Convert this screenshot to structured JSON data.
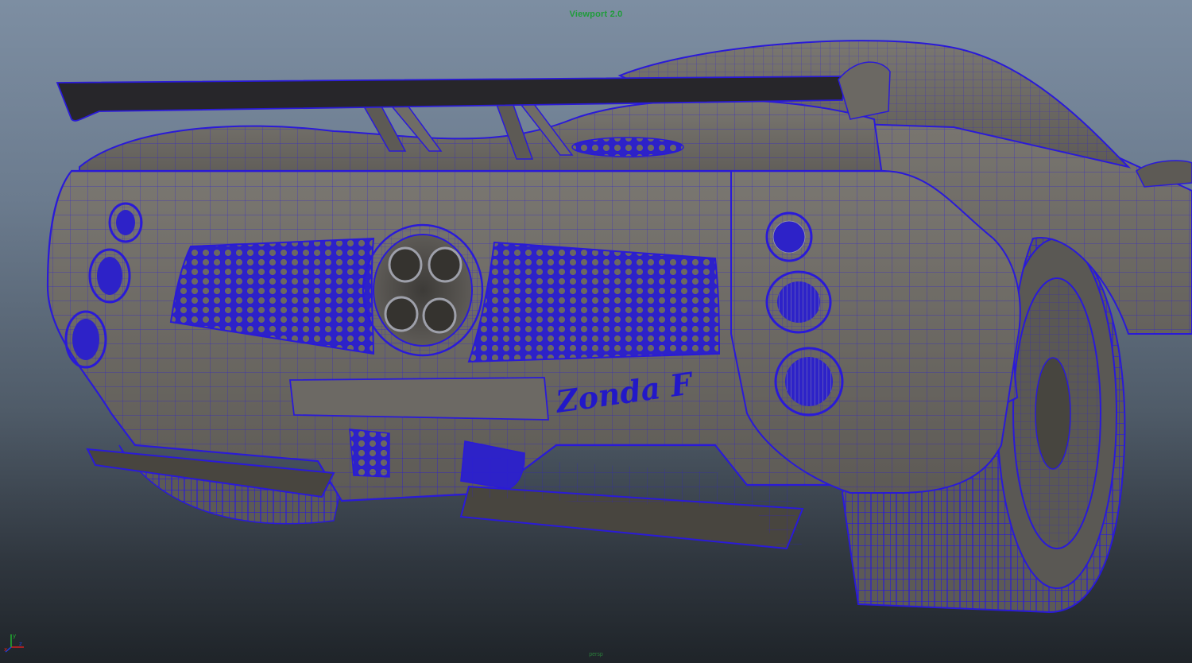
{
  "viewport": {
    "title": "Viewport 2.0",
    "camera_label": "persp"
  },
  "model": {
    "badge_text": "Zonda F",
    "wireframe_color": "#2a1ad8",
    "shaded_color": "#6e6b66"
  },
  "axis_gizmo": {
    "x_label": "x",
    "y_label": "y",
    "z_label": "z",
    "x_color": "#d02020",
    "y_color": "#20b030",
    "z_color": "#2040d0"
  },
  "background": {
    "top_color": "#7d8ea2",
    "bottom_color": "#1f2429"
  }
}
